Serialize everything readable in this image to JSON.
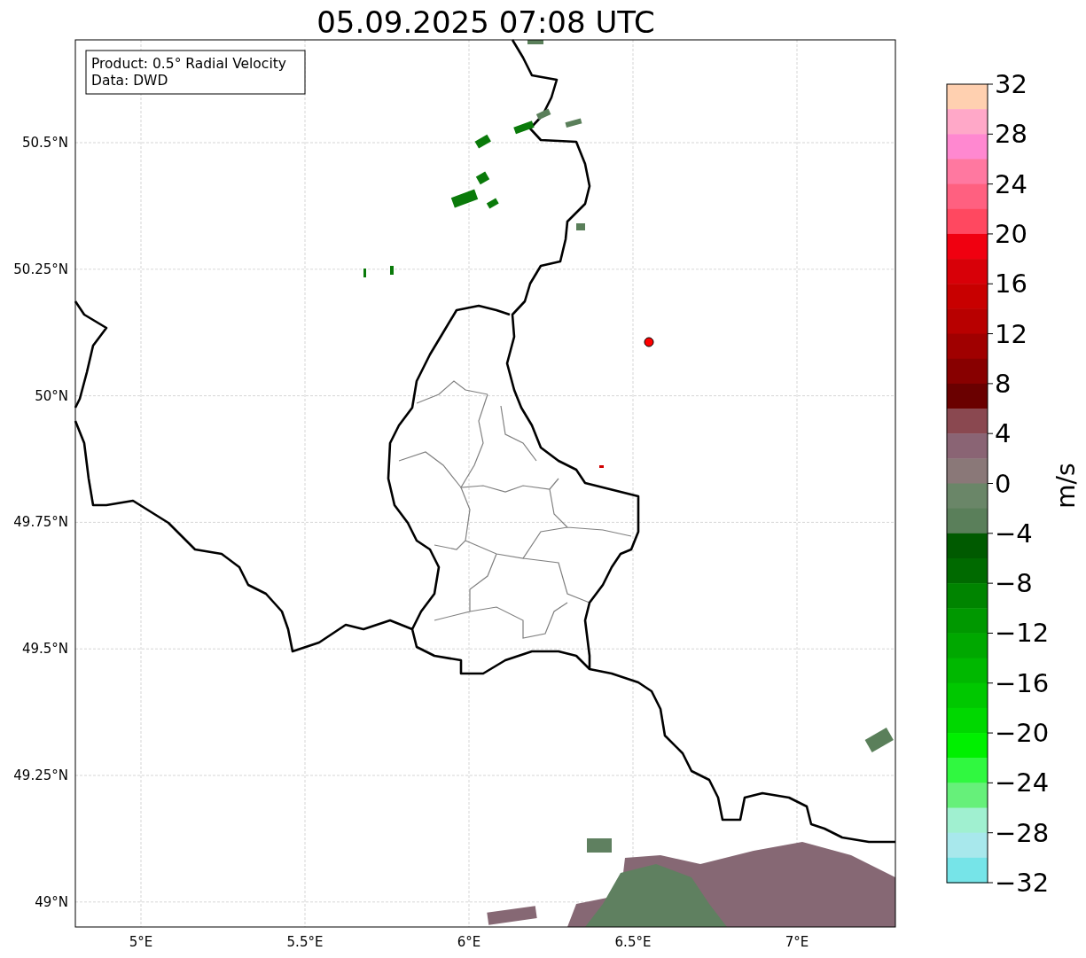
{
  "title": "05.09.2025 07:08 UTC",
  "map": {
    "info_box": [
      "Product: 0.5° Radial Velocity",
      "Data: DWD"
    ],
    "xticks": [
      "5°E",
      "5.5°E",
      "6°E",
      "6.5°E",
      "7°E"
    ],
    "yticks": [
      "50.5°N",
      "50.25°N",
      "50°N",
      "49.75°N",
      "49.5°N",
      "49.25°N",
      "49°N"
    ]
  },
  "colorbar": {
    "label": "m/s",
    "ticks": [
      "32",
      "28",
      "24",
      "20",
      "16",
      "12",
      "8",
      "4",
      "0",
      "−4",
      "−8",
      "−12",
      "−16",
      "−20",
      "−24",
      "−28",
      "−32"
    ],
    "segments": [
      {
        "color": "#ffd0b0"
      },
      {
        "color": "#ffa8c8"
      },
      {
        "color": "#ff88d0"
      },
      {
        "color": "#ff78a0"
      },
      {
        "color": "#ff6080"
      },
      {
        "color": "#ff4860"
      },
      {
        "color": "#f00010"
      },
      {
        "color": "#d80008"
      },
      {
        "color": "#c80000"
      },
      {
        "color": "#b80000"
      },
      {
        "color": "#a00000"
      },
      {
        "color": "#880000"
      },
      {
        "color": "#6a0000"
      },
      {
        "color": "#8a4850"
      },
      {
        "color": "#8a6474"
      },
      {
        "color": "#8a7878"
      },
      {
        "color": "#6a8668"
      },
      {
        "color": "#5a7f5a"
      },
      {
        "color": "#005a00"
      },
      {
        "color": "#006a00"
      },
      {
        "color": "#008400"
      },
      {
        "color": "#009800"
      },
      {
        "color": "#00a800"
      },
      {
        "color": "#00b800"
      },
      {
        "color": "#00c800"
      },
      {
        "color": "#00d800"
      },
      {
        "color": "#00f000"
      },
      {
        "color": "#30f840"
      },
      {
        "color": "#66f07a"
      },
      {
        "color": "#a0f0d0"
      },
      {
        "color": "#a8e8ec"
      },
      {
        "color": "#76e4e8"
      }
    ]
  }
}
